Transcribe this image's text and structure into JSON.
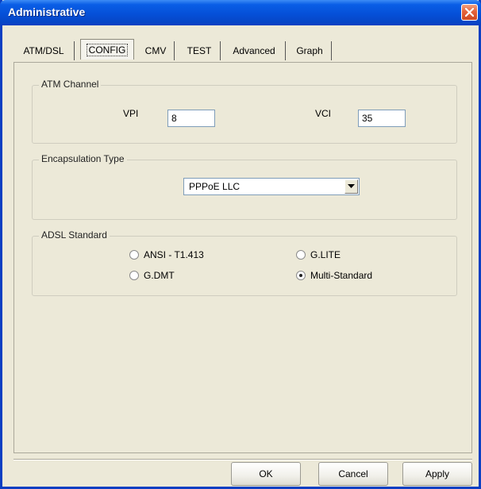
{
  "window": {
    "title": "Administrative",
    "close_icon": "close-icon"
  },
  "tabs": [
    {
      "label": "ATM/DSL",
      "active": false
    },
    {
      "label": "CONFIG",
      "active": true
    },
    {
      "label": "CMV",
      "active": false
    },
    {
      "label": "TEST",
      "active": false
    },
    {
      "label": "Advanced",
      "active": false
    },
    {
      "label": "Graph",
      "active": false
    }
  ],
  "atm_channel": {
    "group_label": "ATM Channel",
    "vpi_label": "VPI",
    "vpi_value": "8",
    "vci_label": "VCI",
    "vci_value": "35"
  },
  "encapsulation": {
    "group_label": "Encapsulation Type",
    "selected": "PPPoE LLC"
  },
  "adsl_standard": {
    "group_label": "ADSL Standard",
    "options": [
      {
        "label": "ANSI - T1.413",
        "checked": false
      },
      {
        "label": "G.LITE",
        "checked": false
      },
      {
        "label": "G.DMT",
        "checked": false
      },
      {
        "label": "Multi-Standard",
        "checked": true
      }
    ]
  },
  "buttons": {
    "ok": "OK",
    "cancel": "Cancel",
    "apply": "Apply"
  },
  "colors": {
    "titlebar": "#0550d8",
    "close": "#e5623a",
    "dialog_bg": "#ece9d8"
  }
}
